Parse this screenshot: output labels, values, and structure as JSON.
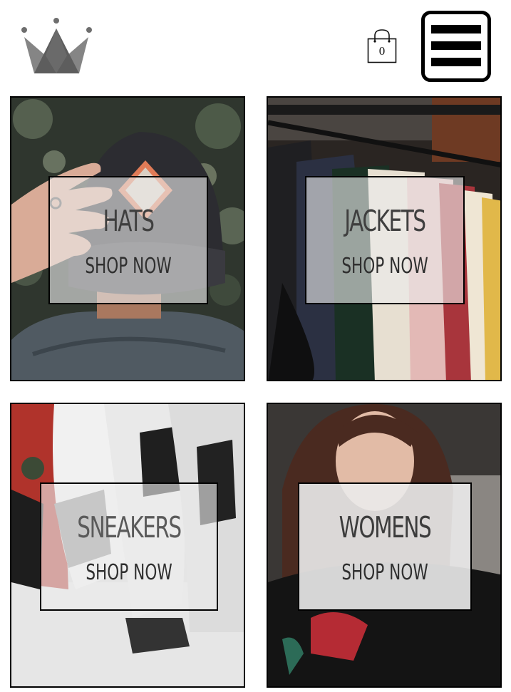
{
  "header": {
    "logo_icon": "crown-icon",
    "cart": {
      "icon": "shopping-bag-icon",
      "count": "0"
    },
    "menu_icon": "hamburger-menu-icon"
  },
  "categories": [
    {
      "title": "HATS",
      "cta": "SHOP NOW"
    },
    {
      "title": "JACKETS",
      "cta": "SHOP NOW"
    },
    {
      "title": "SNEAKERS",
      "cta": "SHOP NOW"
    },
    {
      "title": "WOMENS",
      "cta": "SHOP NOW"
    }
  ],
  "colors": {
    "border": "#000000",
    "logo_gray": "#6e6e6e",
    "label_overlay": "#ebebeb"
  }
}
